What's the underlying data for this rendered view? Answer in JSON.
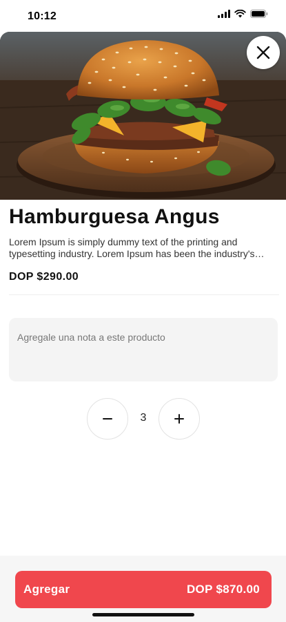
{
  "status_bar": {
    "time": "10:12",
    "icons": [
      "signal-icon",
      "wifi-icon",
      "battery-icon"
    ]
  },
  "hero": {
    "image": "hamburger-photo",
    "close_icon": "close-icon"
  },
  "product": {
    "title": "Hamburguesa Angus",
    "description": "Lorem Ipsum is simply dummy text of the printing and typesetting industry. Lorem Ipsum has been the industry's standard dummy text ever since the 1500s...",
    "price": "DOP $290.00"
  },
  "note": {
    "placeholder": "Agregale una nota a este producto",
    "value": ""
  },
  "quantity": {
    "value": "3",
    "decrement_icon": "minus-icon",
    "increment_icon": "plus-icon"
  },
  "footer": {
    "add_label": "Agregar",
    "total": "DOP $870.00"
  },
  "colors": {
    "accent": "#f0474d",
    "note_background": "#f4f4f4",
    "footer_background": "#f6f6f6"
  }
}
